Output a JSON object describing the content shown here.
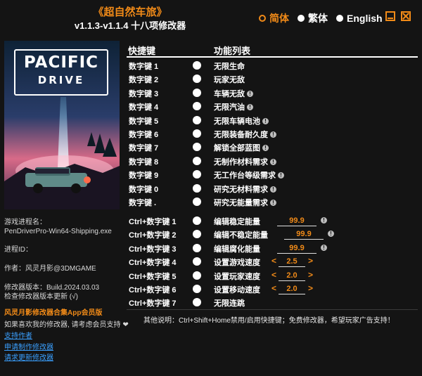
{
  "header": {
    "title": "《超自然车旅》",
    "subtitle": "v1.1.3-v1.1.4 十八项修改器"
  },
  "languages": [
    {
      "label": "简体",
      "selected": true
    },
    {
      "label": "繁体",
      "selected": false
    },
    {
      "label": "English",
      "selected": false
    }
  ],
  "cover": {
    "logo_line1": "PACIFIC",
    "logo_line2": "DRIVE"
  },
  "info": {
    "process_label": "游戏进程名：",
    "process_name": "PenDriverPro-Win64-Shipping.exe",
    "pid_label": "进程ID：",
    "author": "作者：风灵月影@3DMGAME",
    "version": "修改器版本：Build.2024.03.03",
    "check_update": "检查修改器版本更新 (√)",
    "vip_link": "风灵月影修改器合集App会员版",
    "support_text": "如果喜欢我的修改器, 请考虑会员支持 ❤",
    "links": [
      "支持作者",
      "申请制作修改器",
      "请求更新修改器"
    ]
  },
  "table": {
    "col_hotkey": "快捷键",
    "col_function": "功能列表",
    "rows": [
      {
        "key": "数字键 1",
        "func": "无限生命",
        "warn": false
      },
      {
        "key": "数字键 2",
        "func": "玩家无敌",
        "warn": false
      },
      {
        "key": "数字键 3",
        "func": "车辆无敌",
        "warn": true
      },
      {
        "key": "数字键 4",
        "func": "无限汽油",
        "warn": true
      },
      {
        "key": "数字键 5",
        "func": "无限车辆电池",
        "warn": true
      },
      {
        "key": "数字键 6",
        "func": "无限装备耐久度",
        "warn": true
      },
      {
        "key": "数字键 7",
        "func": "解锁全部蓝图",
        "warn": true
      },
      {
        "key": "数字键 8",
        "func": "无制作材料需求",
        "warn": true
      },
      {
        "key": "数字键 9",
        "func": "无工作台等级需求",
        "warn": true
      },
      {
        "key": "数字键 0",
        "func": "研究无材料需求",
        "warn": true
      },
      {
        "key": "数字键 .",
        "func": "研究无能量需求",
        "warn": true
      }
    ],
    "ctrl_rows": [
      {
        "key": "Ctrl+数字键 1",
        "func": "编辑稳定能量",
        "value": "99.9"
      },
      {
        "key": "Ctrl+数字键 2",
        "func": "编辑不稳定能量",
        "value": "99.9"
      },
      {
        "key": "Ctrl+数字键 3",
        "func": "编辑腐化能量",
        "value": "99.9"
      },
      {
        "key": "Ctrl+数字键 4",
        "func": "设置游戏速度",
        "value": "2.5"
      },
      {
        "key": "Ctrl+数字键 5",
        "func": "设置玩家速度",
        "value": "2.0"
      },
      {
        "key": "Ctrl+数字键 6",
        "func": "设置移动速度",
        "value": "2.0"
      },
      {
        "key": "Ctrl+数字键 7",
        "func": "无限连跳",
        "value": ""
      }
    ],
    "arrow_left": "<",
    "arrow_right": ">",
    "warn_glyph": "!"
  },
  "footer_note": "其他说明：Ctrl+Shift+Home禁用/启用快捷键；免费修改器，希望玩家广告支持！",
  "colors": {
    "accent": "#f08a18",
    "background": "#141414",
    "link": "#3aa0ff"
  }
}
